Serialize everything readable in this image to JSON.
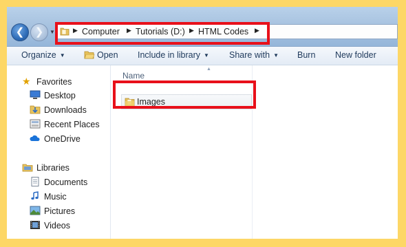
{
  "colors": {
    "frame": "#fdd766",
    "highlight": "#e8101a",
    "nav_text": "#1e395b"
  },
  "nav_buttons": {
    "back_icon": "back-arrow-icon",
    "forward_icon": "forward-arrow-icon"
  },
  "address_bar": {
    "path": [
      "Computer",
      "Tutorials (D:)",
      "HTML Codes"
    ]
  },
  "toolbar": {
    "organize": "Organize",
    "open": "Open",
    "include_in_library": "Include in library",
    "share_with": "Share with",
    "burn": "Burn",
    "new_folder": "New folder"
  },
  "navigation": {
    "favorites": {
      "label": "Favorites",
      "items": [
        "Desktop",
        "Downloads",
        "Recent Places",
        "OneDrive"
      ]
    },
    "libraries": {
      "label": "Libraries",
      "items": [
        "Documents",
        "Music",
        "Pictures",
        "Videos"
      ]
    }
  },
  "file_list": {
    "column_name": "Name",
    "items": [
      "Images"
    ]
  }
}
